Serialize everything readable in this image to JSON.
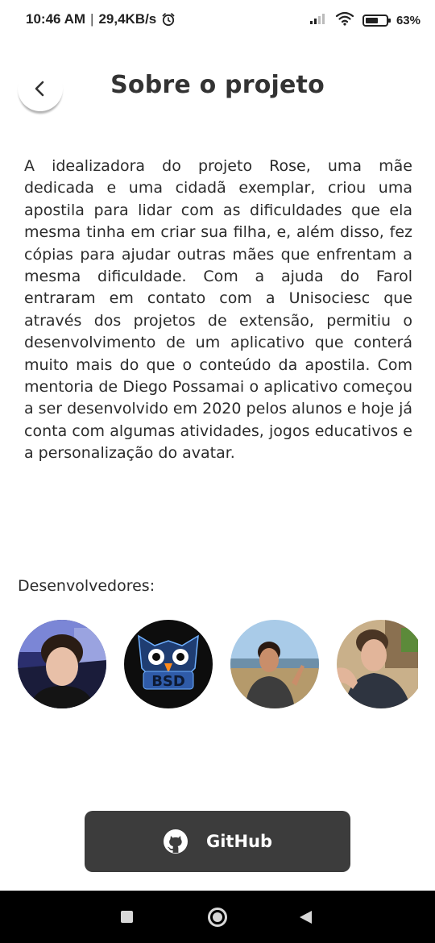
{
  "status_bar": {
    "time": "10:46 AM",
    "separator": "|",
    "network_speed": "29,4KB/s",
    "battery_level": 0.63,
    "battery_text": "63%",
    "icons": [
      "alarm-icon",
      "signal-icon",
      "wifi-icon",
      "battery-icon"
    ]
  },
  "header": {
    "back_icon": "chevron-left-icon",
    "title": "Sobre o projeto"
  },
  "description": "A idealizadora do projeto Rose, uma mãe dedicada e uma cidadã exemplar, criou uma apostila para lidar com as dificuldades que ela mesma tinha em criar sua filha, e, além disso, fez cópias para ajudar outras mães que enfrentam a mesma dificuldade. Com a ajuda do Farol entraram em contato com a Unisociesc que através dos projetos de extensão, permitiu o desenvolvimento de um aplicativo que conterá muito mais do que o conteúdo da apostila. Com mentoria de Diego Possamai o aplicativo começou a ser desenvolvido em 2020 pelos alunos e hoje já conta com algumas atividades, jogos educativos e a personalização do avatar.",
  "developers": {
    "label": "Desenvolvedores:",
    "avatars": [
      {
        "kind": "photo"
      },
      {
        "kind": "logo",
        "text": "BSD"
      },
      {
        "kind": "photo"
      },
      {
        "kind": "photo"
      }
    ]
  },
  "github_button": {
    "icon": "github-icon",
    "label": "GitHub"
  },
  "nav_bar": {
    "icons": [
      "recents-icon",
      "home-icon",
      "back-icon"
    ]
  },
  "colors": {
    "button_bg": "#3c3c3c",
    "text": "#2b2b2b",
    "title": "#333333"
  }
}
